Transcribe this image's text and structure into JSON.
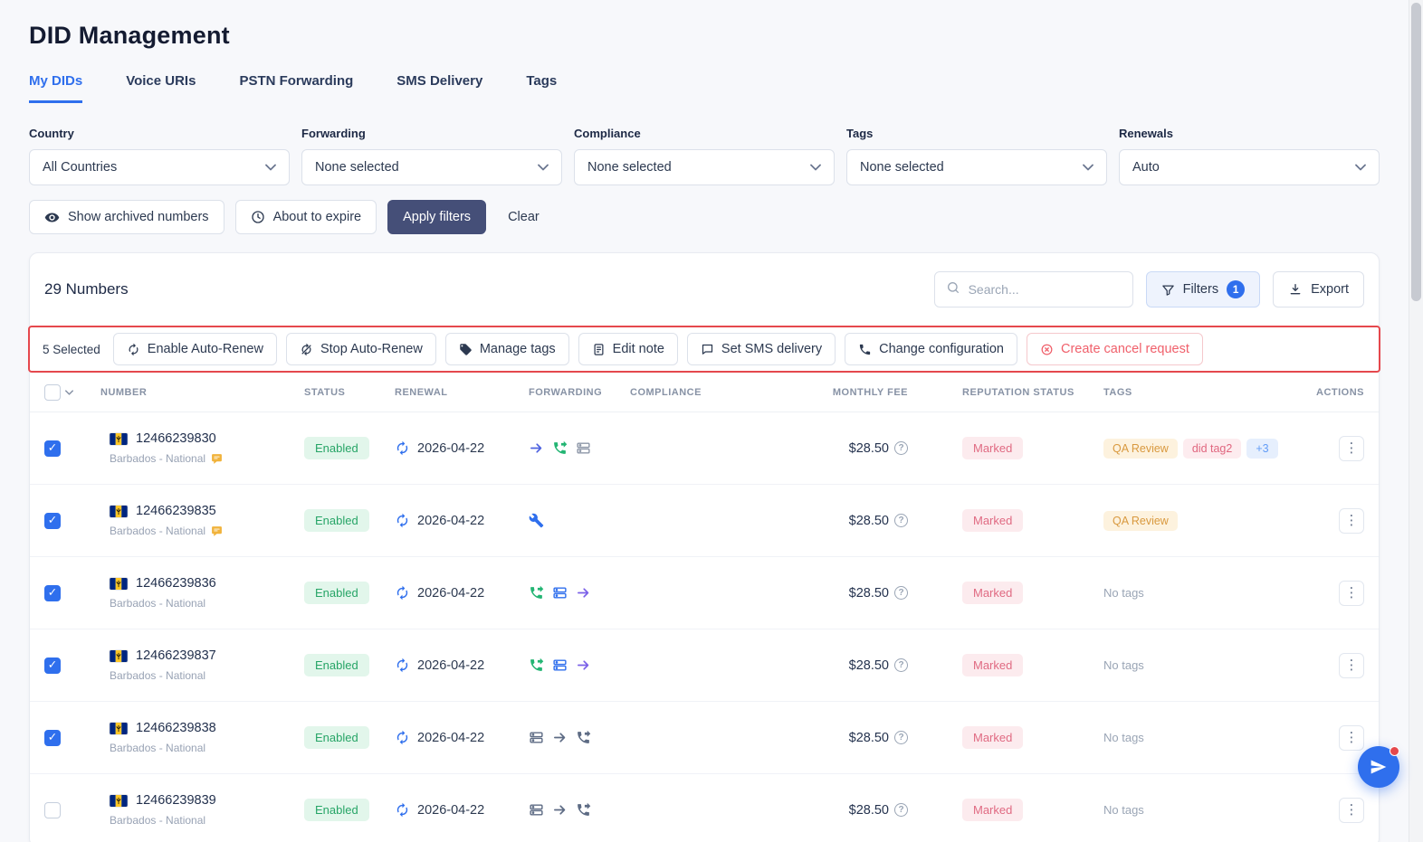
{
  "page": {
    "title": "DID Management"
  },
  "tabs": [
    {
      "label": "My DIDs"
    },
    {
      "label": "Voice URIs"
    },
    {
      "label": "PSTN Forwarding"
    },
    {
      "label": "SMS Delivery"
    },
    {
      "label": "Tags"
    }
  ],
  "filters": {
    "fields": [
      {
        "label": "Country",
        "value": "All Countries"
      },
      {
        "label": "Forwarding",
        "value": "None selected"
      },
      {
        "label": "Compliance",
        "value": "None selected"
      },
      {
        "label": "Tags",
        "value": "None selected"
      },
      {
        "label": "Renewals",
        "value": "Auto"
      }
    ],
    "show_archived_label": "Show archived numbers",
    "about_to_expire_label": "About to expire",
    "apply_label": "Apply filters",
    "clear_label": "Clear"
  },
  "toolbar": {
    "count_label": "29 Numbers",
    "search_placeholder": "Search...",
    "filters_label": "Filters",
    "filters_badge": "1",
    "export_label": "Export"
  },
  "bulk_actions": {
    "selected_label": "5 Selected",
    "enable_auto_renew": "Enable Auto-Renew",
    "stop_auto_renew": "Stop Auto-Renew",
    "manage_tags": "Manage tags",
    "edit_note": "Edit note",
    "set_sms_delivery": "Set SMS delivery",
    "change_configuration": "Change configuration",
    "create_cancel_request": "Create cancel request"
  },
  "table": {
    "columns": [
      "NUMBER",
      "STATUS",
      "RENEWAL",
      "FORWARDING",
      "COMPLIANCE",
      "MONTHLY FEE",
      "REPUTATION STATUS",
      "TAGS",
      "ACTIONS"
    ],
    "no_tags_label": "No tags",
    "rows": [
      {
        "checked": true,
        "number": "12466239830",
        "country": "Barbados - National",
        "note": true,
        "status": "Enabled",
        "renewal": "2026-04-22",
        "forwarding": [
          {
            "icon": "arrow-right",
            "color": "#4f63e0"
          },
          {
            "icon": "phone-forward",
            "color": "#23b573"
          },
          {
            "icon": "server",
            "color": "#8d97a8"
          }
        ],
        "monthly_fee": "$28.50",
        "reputation": "Marked",
        "tags": [
          {
            "label": "QA Review",
            "style": "amber"
          },
          {
            "label": "did tag2",
            "style": "rose"
          },
          {
            "label": "+3",
            "style": "blue"
          }
        ]
      },
      {
        "checked": true,
        "number": "12466239835",
        "country": "Barbados - National",
        "note": true,
        "status": "Enabled",
        "renewal": "2026-04-22",
        "forwarding": [
          {
            "icon": "wrench",
            "color": "#2f6fed"
          }
        ],
        "monthly_fee": "$28.50",
        "reputation": "Marked",
        "tags": [
          {
            "label": "QA Review",
            "style": "amber"
          }
        ]
      },
      {
        "checked": true,
        "number": "12466239836",
        "country": "Barbados - National",
        "note": false,
        "status": "Enabled",
        "renewal": "2026-04-22",
        "forwarding": [
          {
            "icon": "phone-forward",
            "color": "#23b573"
          },
          {
            "icon": "server",
            "color": "#2f6fed"
          },
          {
            "icon": "arrow-right",
            "color": "#7b61e8"
          }
        ],
        "monthly_fee": "$28.50",
        "reputation": "Marked",
        "tags": []
      },
      {
        "checked": true,
        "number": "12466239837",
        "country": "Barbados - National",
        "note": false,
        "status": "Enabled",
        "renewal": "2026-04-22",
        "forwarding": [
          {
            "icon": "phone-forward",
            "color": "#23b573"
          },
          {
            "icon": "server",
            "color": "#2f6fed"
          },
          {
            "icon": "arrow-right",
            "color": "#7b61e8"
          }
        ],
        "monthly_fee": "$28.50",
        "reputation": "Marked",
        "tags": []
      },
      {
        "checked": true,
        "number": "12466239838",
        "country": "Barbados - National",
        "note": false,
        "status": "Enabled",
        "renewal": "2026-04-22",
        "forwarding": [
          {
            "icon": "server",
            "color": "#5d6b84"
          },
          {
            "icon": "arrow-right",
            "color": "#5d6b84"
          },
          {
            "icon": "phone-forward",
            "color": "#5d6b84"
          }
        ],
        "monthly_fee": "$28.50",
        "reputation": "Marked",
        "tags": []
      },
      {
        "checked": false,
        "number": "12466239839",
        "country": "Barbados - National",
        "note": false,
        "status": "Enabled",
        "renewal": "2026-04-22",
        "forwarding": [
          {
            "icon": "server",
            "color": "#5d6b84"
          },
          {
            "icon": "arrow-right",
            "color": "#5d6b84"
          },
          {
            "icon": "phone-forward",
            "color": "#5d6b84"
          }
        ],
        "monthly_fee": "$28.50",
        "reputation": "Marked",
        "tags": []
      }
    ]
  },
  "colors": {
    "accent": "#2f6fed",
    "primary-button": "#454f78",
    "danger": "#e5484d",
    "status-enabled-bg": "#e2f6eb",
    "status-enabled-text": "#27a567",
    "reputation-marked-bg": "#fcebee",
    "reputation-marked-text": "#e06a82"
  }
}
